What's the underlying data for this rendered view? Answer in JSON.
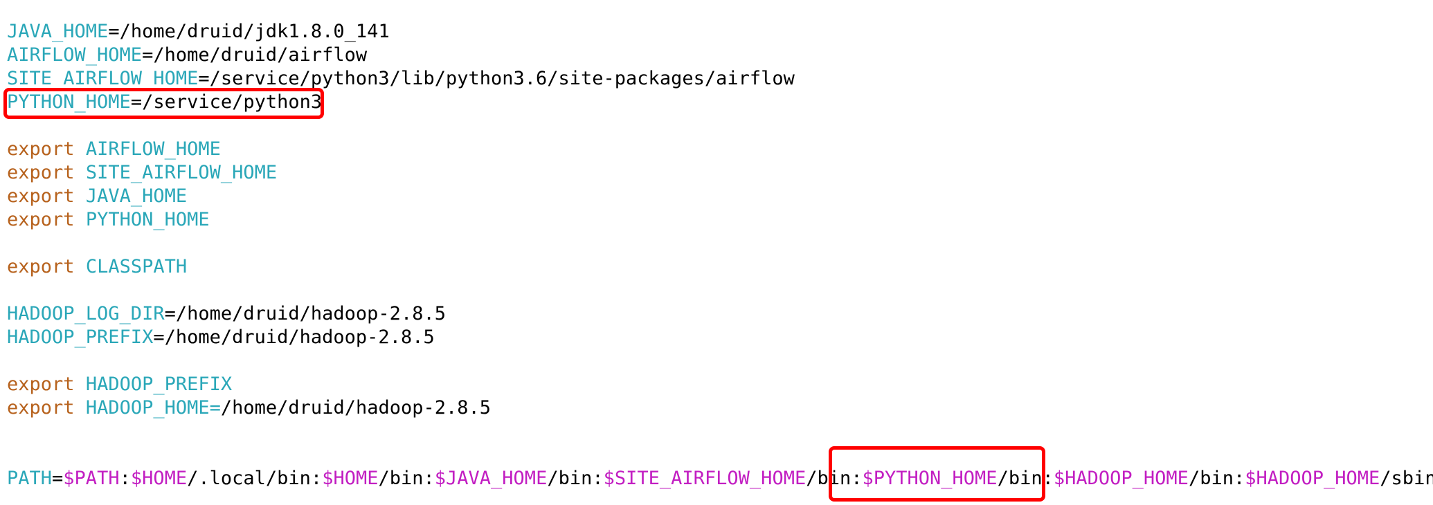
{
  "editor": {
    "lines": [
      {
        "id": "l1",
        "tokens": [
          {
            "t": "var",
            "v": "JAVA_HOME"
          },
          {
            "t": "plain",
            "v": "=/home/druid/jdk1.8.0_141"
          }
        ]
      },
      {
        "id": "l2",
        "tokens": [
          {
            "t": "var",
            "v": "AIRFLOW_HOME"
          },
          {
            "t": "plain",
            "v": "=/home/druid/airflow"
          }
        ]
      },
      {
        "id": "l3",
        "tokens": [
          {
            "t": "var",
            "v": "SITE_AIRFLOW_HOME"
          },
          {
            "t": "plain",
            "v": "=/service/python3/lib/python3.6/site-packages/airflow"
          }
        ]
      },
      {
        "id": "l4",
        "tokens": [
          {
            "t": "var",
            "v": "PYTHON_HOME"
          },
          {
            "t": "plain",
            "v": "=/service/python3"
          }
        ]
      },
      {
        "id": "l6",
        "tokens": [
          {
            "t": "kw",
            "v": "export"
          },
          {
            "t": "plain",
            "v": " "
          },
          {
            "t": "var",
            "v": "AIRFLOW_HOME"
          }
        ]
      },
      {
        "id": "l7",
        "tokens": [
          {
            "t": "kw",
            "v": "export"
          },
          {
            "t": "plain",
            "v": " "
          },
          {
            "t": "var",
            "v": "SITE_AIRFLOW_HOME"
          }
        ]
      },
      {
        "id": "l8",
        "tokens": [
          {
            "t": "kw",
            "v": "export"
          },
          {
            "t": "plain",
            "v": " "
          },
          {
            "t": "var",
            "v": "JAVA_HOME"
          }
        ]
      },
      {
        "id": "l9",
        "tokens": [
          {
            "t": "kw",
            "v": "export"
          },
          {
            "t": "plain",
            "v": " "
          },
          {
            "t": "var",
            "v": "PYTHON_HOME"
          }
        ]
      },
      {
        "id": "l11",
        "tokens": [
          {
            "t": "kw",
            "v": "export"
          },
          {
            "t": "plain",
            "v": " "
          },
          {
            "t": "var",
            "v": "CLASSPATH"
          }
        ]
      },
      {
        "id": "l13",
        "tokens": [
          {
            "t": "var",
            "v": "HADOOP_LOG_DIR"
          },
          {
            "t": "plain",
            "v": "=/home/druid/hadoop-2.8.5"
          }
        ]
      },
      {
        "id": "l14",
        "tokens": [
          {
            "t": "var",
            "v": "HADOOP_PREFIX"
          },
          {
            "t": "plain",
            "v": "=/home/druid/hadoop-2.8.5"
          }
        ]
      },
      {
        "id": "l16",
        "tokens": [
          {
            "t": "kw",
            "v": "export"
          },
          {
            "t": "plain",
            "v": " "
          },
          {
            "t": "var",
            "v": "HADOOP_PREFIX"
          }
        ]
      },
      {
        "id": "l17",
        "tokens": [
          {
            "t": "kw",
            "v": "export"
          },
          {
            "t": "plain",
            "v": " "
          },
          {
            "t": "var",
            "v": "HADOOP_HOME="
          },
          {
            "t": "plain",
            "v": "/home/druid/hadoop-2.8.5"
          }
        ]
      },
      {
        "id": "l20",
        "tokens": [
          {
            "t": "var",
            "v": "PATH"
          },
          {
            "t": "plain",
            "v": "="
          },
          {
            "t": "sym",
            "v": "$PATH"
          },
          {
            "t": "plain",
            "v": ":"
          },
          {
            "t": "sym",
            "v": "$HOME"
          },
          {
            "t": "plain",
            "v": "/.local/bin:"
          },
          {
            "t": "sym",
            "v": "$HOME"
          },
          {
            "t": "plain",
            "v": "/bin:"
          },
          {
            "t": "sym",
            "v": "$JAVA_HOME"
          },
          {
            "t": "plain",
            "v": "/bin:"
          },
          {
            "t": "sym",
            "v": "$SITE_AIRFLOW_HOME"
          },
          {
            "t": "plain",
            "v": "/bin:"
          },
          {
            "t": "sym",
            "v": "$PYTHON_HOME"
          },
          {
            "t": "plain",
            "v": "/bin:"
          },
          {
            "t": "sym",
            "v": "$HADOOP_HOME"
          },
          {
            "t": "plain",
            "v": "/bin:"
          },
          {
            "t": "sym",
            "v": "$HADOOP_HOME"
          },
          {
            "t": "plain",
            "v": "/sbin"
          }
        ]
      }
    ]
  },
  "colors": {
    "variable": "#2aa7b8",
    "keyword": "#b7621d",
    "dollar_var": "#c21ec2",
    "text": "#000000",
    "highlight_box": "#ff0000"
  }
}
